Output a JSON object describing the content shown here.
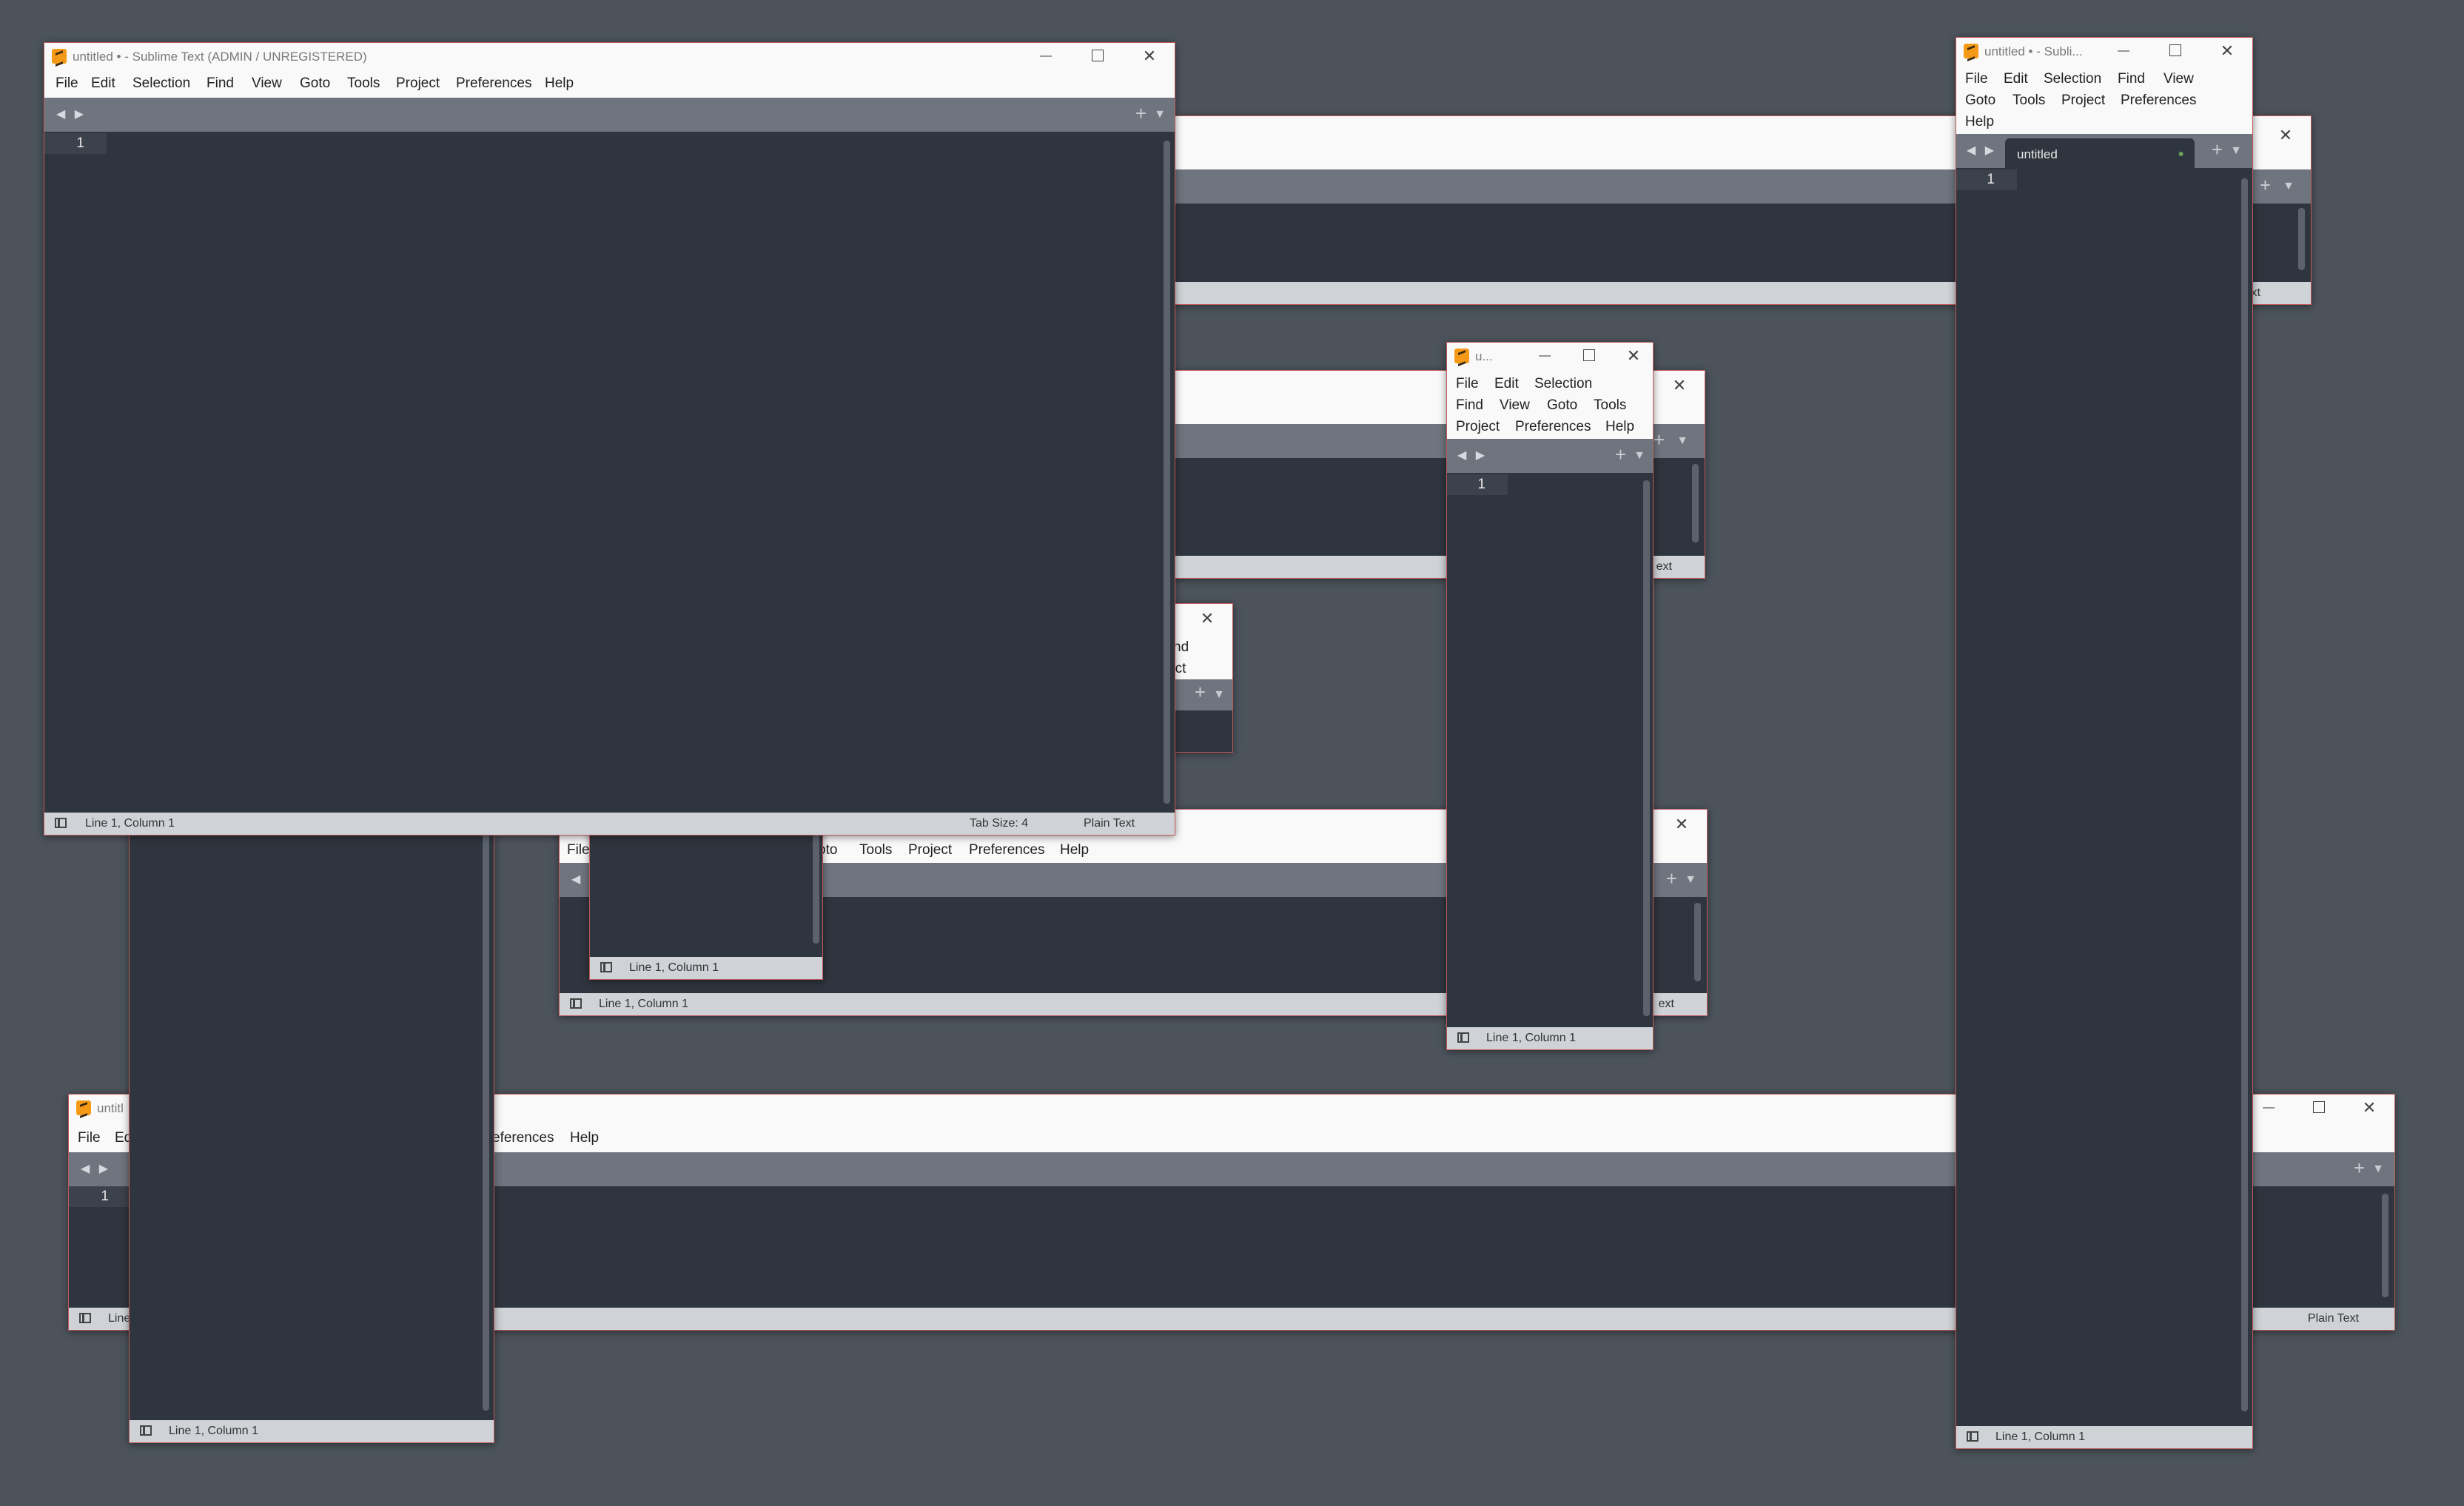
{
  "menu": {
    "file": "File",
    "edit": "Edit",
    "selection": "Selection",
    "find": "Find",
    "view": "View",
    "goto": "Goto",
    "tools": "Tools",
    "project": "Project",
    "preferences": "Preferences",
    "help": "Help",
    "file_cut": "File",
    "edit_cut": "Ed",
    "goto_cut": "oto",
    "preferences_cut": "eferences",
    "find_cut": "nd",
    "project_cut": "ect"
  },
  "status": {
    "position": "Line 1, Column 1",
    "position_cut": "Line",
    "tab_size": "Tab Size: 4",
    "syntax": "Plain Text",
    "syntax_cut_text": "Text",
    "syntax_cut_ext": "ext"
  },
  "editor": {
    "line_number": "1"
  },
  "windows": {
    "main": {
      "title": "untitled • - Sublime Text (ADMIN / UNREGISTERED)"
    },
    "right": {
      "title": "untitled • - Subli...",
      "tab_label": "untitled"
    },
    "small": {
      "title": "u..."
    },
    "bottom": {
      "title": "untitl"
    }
  },
  "glyphs": {
    "close": "✕",
    "minimize": "—",
    "arrows": "◀ ▶",
    "plus": "+",
    "dropdown": "▼",
    "dirty_dot": "●"
  },
  "colors": {
    "desktop": "#4c535b",
    "editor_bg": "#2f353e",
    "tabbar_bg": "#6e757e",
    "statusbar_bg": "#cfd2d6",
    "window_border": "#c05a5a",
    "icon_accent": "#f59a16",
    "dirty_dot": "#6aa35b"
  }
}
